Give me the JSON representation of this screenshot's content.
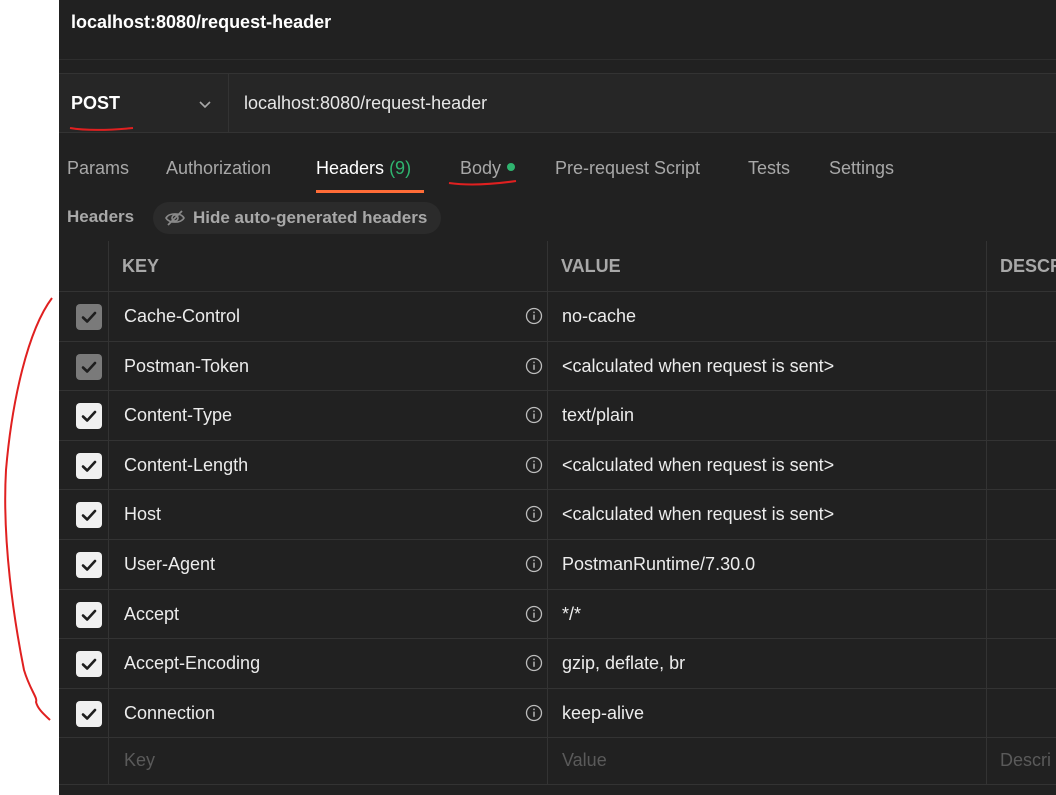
{
  "window": {
    "title": "localhost:8080/request-header"
  },
  "request": {
    "method": "POST",
    "url": "localhost:8080/request-header"
  },
  "tabs": [
    {
      "label": "Params"
    },
    {
      "label": "Authorization"
    },
    {
      "label": "Headers",
      "count": "(9)"
    },
    {
      "label": "Body"
    },
    {
      "label": "Pre-request Script"
    },
    {
      "label": "Tests"
    },
    {
      "label": "Settings"
    }
  ],
  "headers_section": {
    "title": "Headers",
    "hide_button": "Hide auto-generated headers"
  },
  "table": {
    "columns": {
      "key": "KEY",
      "value": "VALUE",
      "description": "DESCR"
    },
    "rows": [
      {
        "key": "Cache-Control",
        "value": "no-cache",
        "checked": true,
        "disabled": true
      },
      {
        "key": "Postman-Token",
        "value": "<calculated when request is sent>",
        "checked": true,
        "disabled": true
      },
      {
        "key": "Content-Type",
        "value": "text/plain",
        "checked": true,
        "disabled": false
      },
      {
        "key": "Content-Length",
        "value": "<calculated when request is sent>",
        "checked": true,
        "disabled": false
      },
      {
        "key": "Host",
        "value": "<calculated when request is sent>",
        "checked": true,
        "disabled": false
      },
      {
        "key": "User-Agent",
        "value": "PostmanRuntime/7.30.0",
        "checked": true,
        "disabled": false
      },
      {
        "key": "Accept",
        "value": "*/*",
        "checked": true,
        "disabled": false
      },
      {
        "key": "Accept-Encoding",
        "value": "gzip, deflate, br",
        "checked": true,
        "disabled": false
      },
      {
        "key": "Connection",
        "value": "keep-alive",
        "checked": true,
        "disabled": false
      }
    ],
    "placeholders": {
      "key": "Key",
      "value": "Value",
      "description": "Descri"
    }
  },
  "colors": {
    "accent": "#ff6c37",
    "success": "#2fb46f",
    "annotation": "#e02020"
  }
}
